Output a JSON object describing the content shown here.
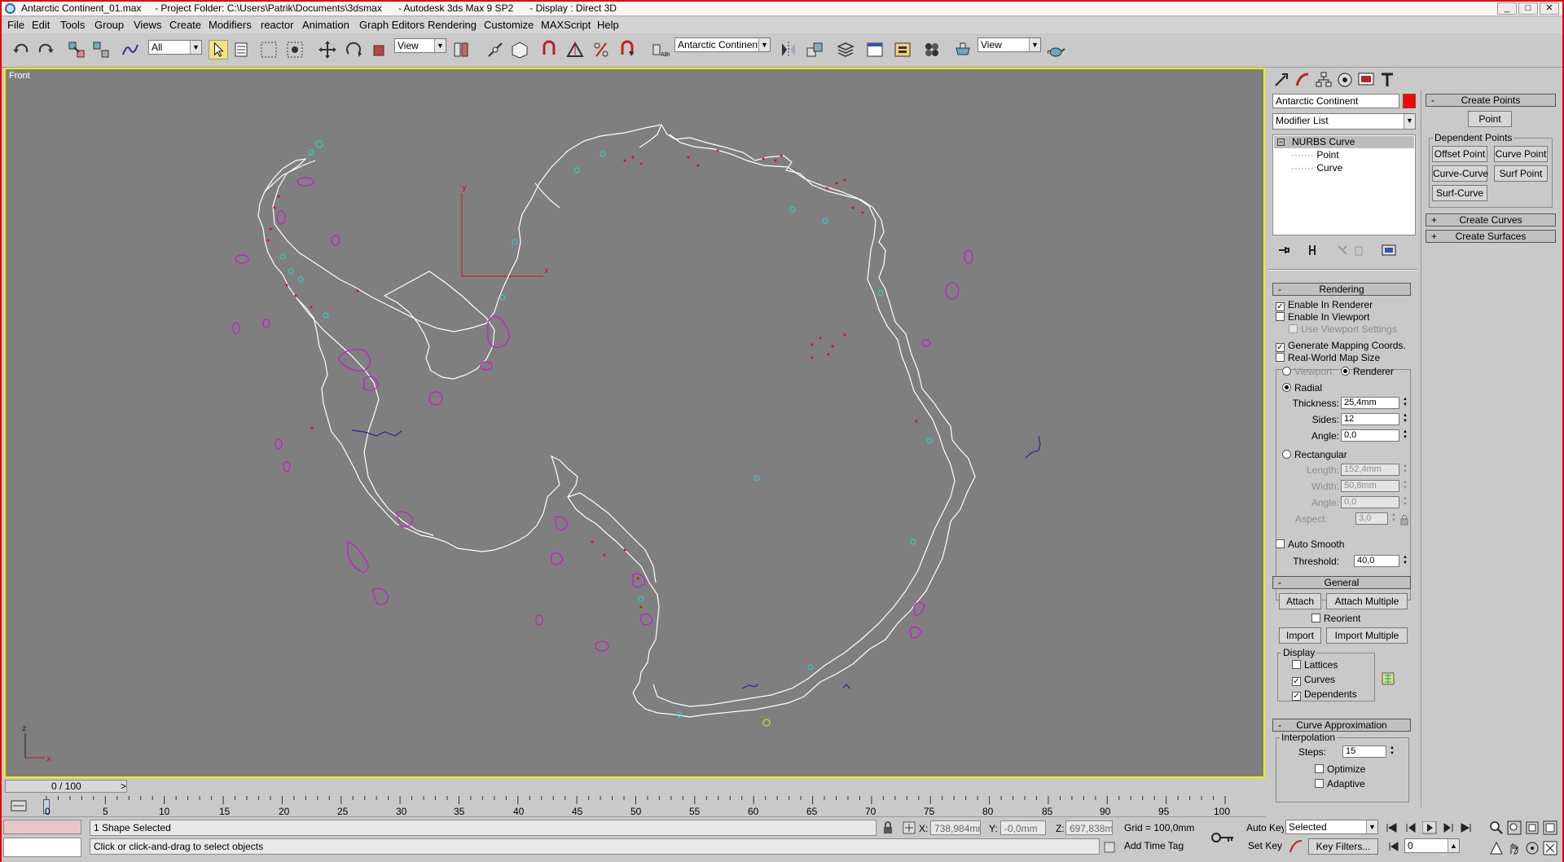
{
  "titlebar": {
    "title": "Antarctic Continent_01.max     - Project Folder: C:\\Users\\Patrik\\Documents\\3dsmax      - Autodesk 3ds Max 9 SP2      - Display : Direct 3D",
    "minimize": "_",
    "maximize": "□",
    "close": "✕"
  },
  "menu": [
    "File",
    "Edit",
    "Tools",
    "Group",
    "Views",
    "Create",
    "Modifiers",
    "reactor",
    "Animation",
    "Graph Editors",
    "Rendering",
    "Customize",
    "MAXScript",
    "Help"
  ],
  "toolbar": {
    "selection_filter": "All",
    "ref_coord": "View",
    "named_selection": "Antarctic Continent",
    "render_view": "View"
  },
  "viewport": {
    "label": "Front",
    "axis_y": "y",
    "axis_x": "x",
    "axis_z": "z",
    "axis_x2": "x"
  },
  "timeslider": {
    "frame": "0 / 100",
    "prev": "<",
    "next": ">"
  },
  "timeline": {
    "ticks": [
      "0",
      "5",
      "10",
      "15",
      "20",
      "25",
      "30",
      "35",
      "40",
      "45",
      "50",
      "55",
      "60",
      "65",
      "70",
      "75",
      "80",
      "85",
      "90",
      "95",
      "100"
    ]
  },
  "status": {
    "selected": "1 Shape Selected",
    "prompt": "Click or click-and-drag to select objects",
    "x_label": "X:",
    "x_value": "738,984mm",
    "y_label": "Y:",
    "y_value": "-0,0mm",
    "z_label": "Z:",
    "z_value": "697,838mm",
    "grid": "Grid = 100,0mm",
    "add_time_tag": "Add Time Tag",
    "auto_key": "Auto Key",
    "set_key": "Set Key",
    "key_mode": "Selected",
    "key_filters": "Key Filters...",
    "frame_field": "0"
  },
  "cmdpanel": {
    "object_name": "Antarctic Continent",
    "object_color": "#ff0000",
    "modifier_list": "Modifier List",
    "stack": [
      "NURBS Curve",
      "Point",
      "Curve"
    ],
    "rendering": {
      "header": "Rendering",
      "enable_renderer": "Enable In Renderer",
      "enable_viewport": "Enable In Viewport",
      "use_viewport_settings": "Use Viewport Settings",
      "gen_mapping": "Generate Mapping Coords.",
      "real_world": "Real-World Map Size",
      "viewport_radio": "Viewport",
      "renderer_radio": "Renderer",
      "radial": "Radial",
      "thickness_label": "Thickness:",
      "thickness": "25,4mm",
      "sides_label": "Sides:",
      "sides": "12",
      "angle_label": "Angle:",
      "angle": "0,0",
      "rectangular": "Rectangular",
      "length_label": "Length:",
      "length": "152,4mm",
      "width_label": "Width:",
      "width": "50,8mm",
      "angle2_label": "Angle:",
      "angle2": "0,0",
      "aspect_label": "Aspect:",
      "aspect": "3,0",
      "auto_smooth": "Auto Smooth",
      "threshold_label": "Threshold:",
      "threshold": "40,0"
    },
    "general": {
      "header": "General",
      "attach": "Attach",
      "attach_multiple": "Attach Multiple",
      "reorient": "Reorient",
      "import": "Import",
      "import_multiple": "Import Multiple",
      "display": "Display",
      "lattices": "Lattices",
      "curves": "Curves",
      "dependents": "Dependents"
    },
    "curve_approx": {
      "header": "Curve Approximation",
      "interpolation": "Interpolation",
      "steps_label": "Steps:",
      "steps": "15",
      "optimize": "Optimize",
      "adaptive": "Adaptive"
    },
    "create_points": {
      "header": "Create Points",
      "point": "Point",
      "dependent_points": "Dependent Points",
      "offset_point": "Offset Point",
      "curve_point": "Curve Point",
      "curve_curve": "Curve-Curve",
      "surf_point": "Surf Point",
      "surf_curve": "Surf-Curve"
    },
    "create_curves": "Create Curves",
    "create_surfaces": "Create Surfaces",
    "minus": "-",
    "plus": "+",
    "check": "✓"
  }
}
